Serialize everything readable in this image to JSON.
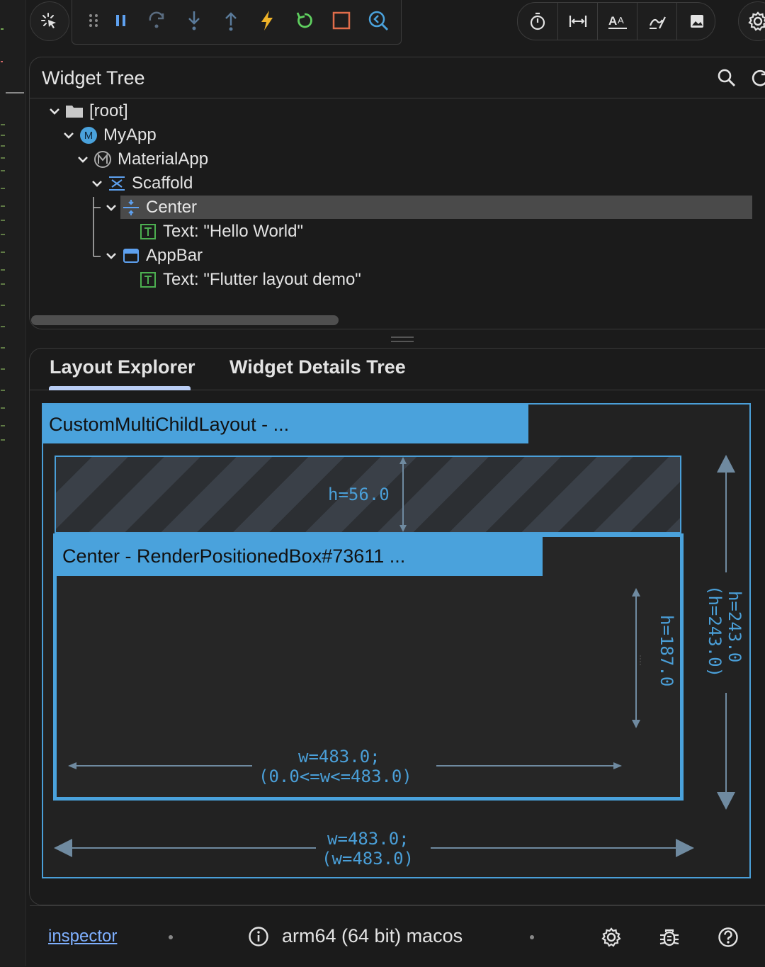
{
  "toolbar": {
    "left_icons": [
      "select-widget-mode-icon"
    ],
    "debug_icons": [
      "drag-handle-icon",
      "pause-icon",
      "step-over-icon",
      "step-into-icon",
      "step-out-icon",
      "hot-reload-icon",
      "hot-restart-icon",
      "stop-icon",
      "devtools-icon"
    ],
    "right_icons": [
      "stopwatch-icon",
      "width-measure-icon",
      "font-size-icon",
      "paint-baseline-icon",
      "image-icon"
    ],
    "settings_icon": "settings-icon"
  },
  "widget_tree": {
    "title": "Widget Tree",
    "icons": [
      "search-icon",
      "refresh-icon"
    ],
    "rows": [
      {
        "label": "[root]",
        "icon": "folder-icon"
      },
      {
        "label": "MyApp",
        "icon": "m-badge-icon"
      },
      {
        "label": "MaterialApp",
        "icon": "material-app-icon"
      },
      {
        "label": "Scaffold",
        "icon": "scaffold-icon"
      },
      {
        "label": "Center",
        "icon": "center-icon",
        "selected": true
      },
      {
        "label": "Text: \"Hello World\"",
        "icon": "text-icon"
      },
      {
        "label": "AppBar",
        "icon": "appbar-icon"
      },
      {
        "label": "Text: \"Flutter layout demo\"",
        "icon": "text-icon"
      }
    ]
  },
  "details": {
    "tabs": [
      {
        "label": "Layout Explorer",
        "active": true
      },
      {
        "label": "Widget Details Tree",
        "active": false
      }
    ],
    "layout": {
      "outer_label": "CustomMultiChildLayout - ...",
      "appbar_height": "h=56.0",
      "center_label": "Center - RenderPositionedBox#73611 ...",
      "center_height": "h=187.0",
      "center_width_line1": "w=483.0;",
      "center_width_line2": "(0.0<=w<=483.0)",
      "outer_height_line1": "h=243.0",
      "outer_height_line2": "(h=243.0)",
      "outer_width_line1": "w=483.0;",
      "outer_width_line2": "(w=483.0)"
    }
  },
  "status_bar": {
    "link": "inspector",
    "device": "arm64 (64 bit) macos",
    "icons": [
      "info-icon",
      "settings-icon",
      "bug-icon",
      "help-icon"
    ]
  },
  "colors": {
    "accent_blue": "#4aa2dc",
    "tab_underline": "#b9cdf4",
    "hot_reload": "#f0b429",
    "hot_restart": "#5fcf5f",
    "stop": "#e06c4a",
    "text_widget_green": "#4caf50"
  }
}
